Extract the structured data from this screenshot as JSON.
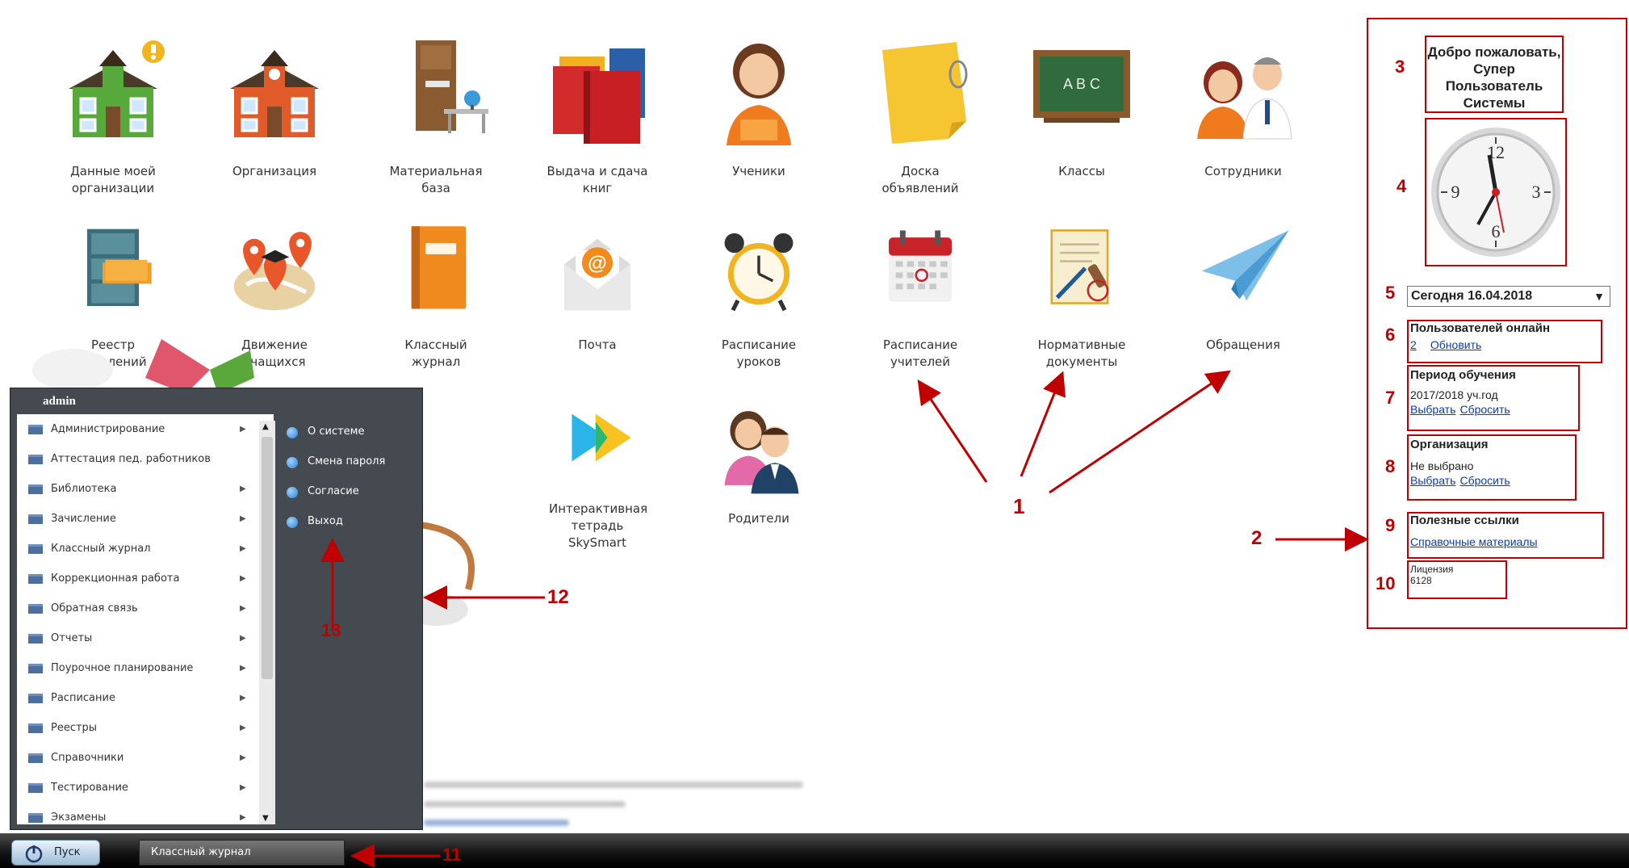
{
  "desktop_icons": [
    {
      "key": "my_org",
      "label": "Данные моей организации",
      "icon": "school-building-icon"
    },
    {
      "key": "org",
      "label": "Организация",
      "icon": "school-building-icon"
    },
    {
      "key": "material",
      "label": "Материальная база",
      "icon": "door-desk-icon"
    },
    {
      "key": "books",
      "label": "Выдача и сдача книг",
      "icon": "books-icon"
    },
    {
      "key": "students",
      "label": "Ученики",
      "icon": "student-icon"
    },
    {
      "key": "board",
      "label": "Доска объявлений",
      "icon": "sticky-note-icon"
    },
    {
      "key": "classes",
      "label": "Классы",
      "icon": "chalkboard-icon"
    },
    {
      "key": "staff",
      "label": "Сотрудники",
      "icon": "staff-icon"
    },
    {
      "key": "register",
      "label": "Реестр заявлений",
      "icon": "file-cabinet-icon"
    },
    {
      "key": "movement",
      "label": "Движение учащихся",
      "icon": "map-pins-icon"
    },
    {
      "key": "journal",
      "label": "Классный журнал",
      "icon": "notebook-icon"
    },
    {
      "key": "mail",
      "label": "Почта",
      "icon": "mail-icon"
    },
    {
      "key": "lessons",
      "label": "Расписание уроков",
      "icon": "alarm-clock-icon"
    },
    {
      "key": "teachers",
      "label": "Расписание учителей",
      "icon": "calendar-icon"
    },
    {
      "key": "normative",
      "label": "Нормативные документы",
      "icon": "document-stamp-icon"
    },
    {
      "key": "appeals",
      "label": "Обращения",
      "icon": "paper-plane-icon"
    },
    {
      "key": "skysmart",
      "label": "Интерактивная тетрадь SkySmart",
      "icon": "skysmart-icon"
    },
    {
      "key": "parents",
      "label": "Родители",
      "icon": "parents-icon"
    }
  ],
  "side_panel": {
    "welcome": "Добро пожаловать, Супер Пользователь Системы",
    "date": "Сегодня 16.04.2018",
    "users_online_title": "Пользователей онлайн",
    "users_online_count": "2",
    "refresh": "Обновить",
    "period_title": "Период обучения",
    "period_value": "2017/2018 уч.год",
    "choose": "Выбрать",
    "reset": "Сбросить",
    "org_title": "Организация",
    "org_value": "Не выбрано",
    "links_title": "Полезные ссылки",
    "links_item": "Справочные материалы",
    "license_title": "Лицензия",
    "license_value": "6128"
  },
  "clock": {
    "numbers": [
      "12",
      "3",
      "6",
      "9"
    ]
  },
  "annotations": [
    "1",
    "2",
    "3",
    "4",
    "5",
    "6",
    "7",
    "8",
    "9",
    "10",
    "11",
    "12",
    "13"
  ],
  "start_menu": {
    "user": "admin",
    "items": [
      "Администрирование",
      "Аттестация пед. работников",
      "Библиотека",
      "Зачисление",
      "Классный журнал",
      "Коррекционная работа",
      "Обратная связь",
      "Отчеты",
      "Поурочное планирование",
      "Расписание",
      "Реестры",
      "Справочники",
      "Тестирование",
      "Экзамены"
    ],
    "right_items": [
      "О системе",
      "Смена пароля",
      "Согласие",
      "Выход"
    ]
  },
  "taskbar": {
    "start": "Пуск",
    "open_window": "Классный журнал"
  }
}
